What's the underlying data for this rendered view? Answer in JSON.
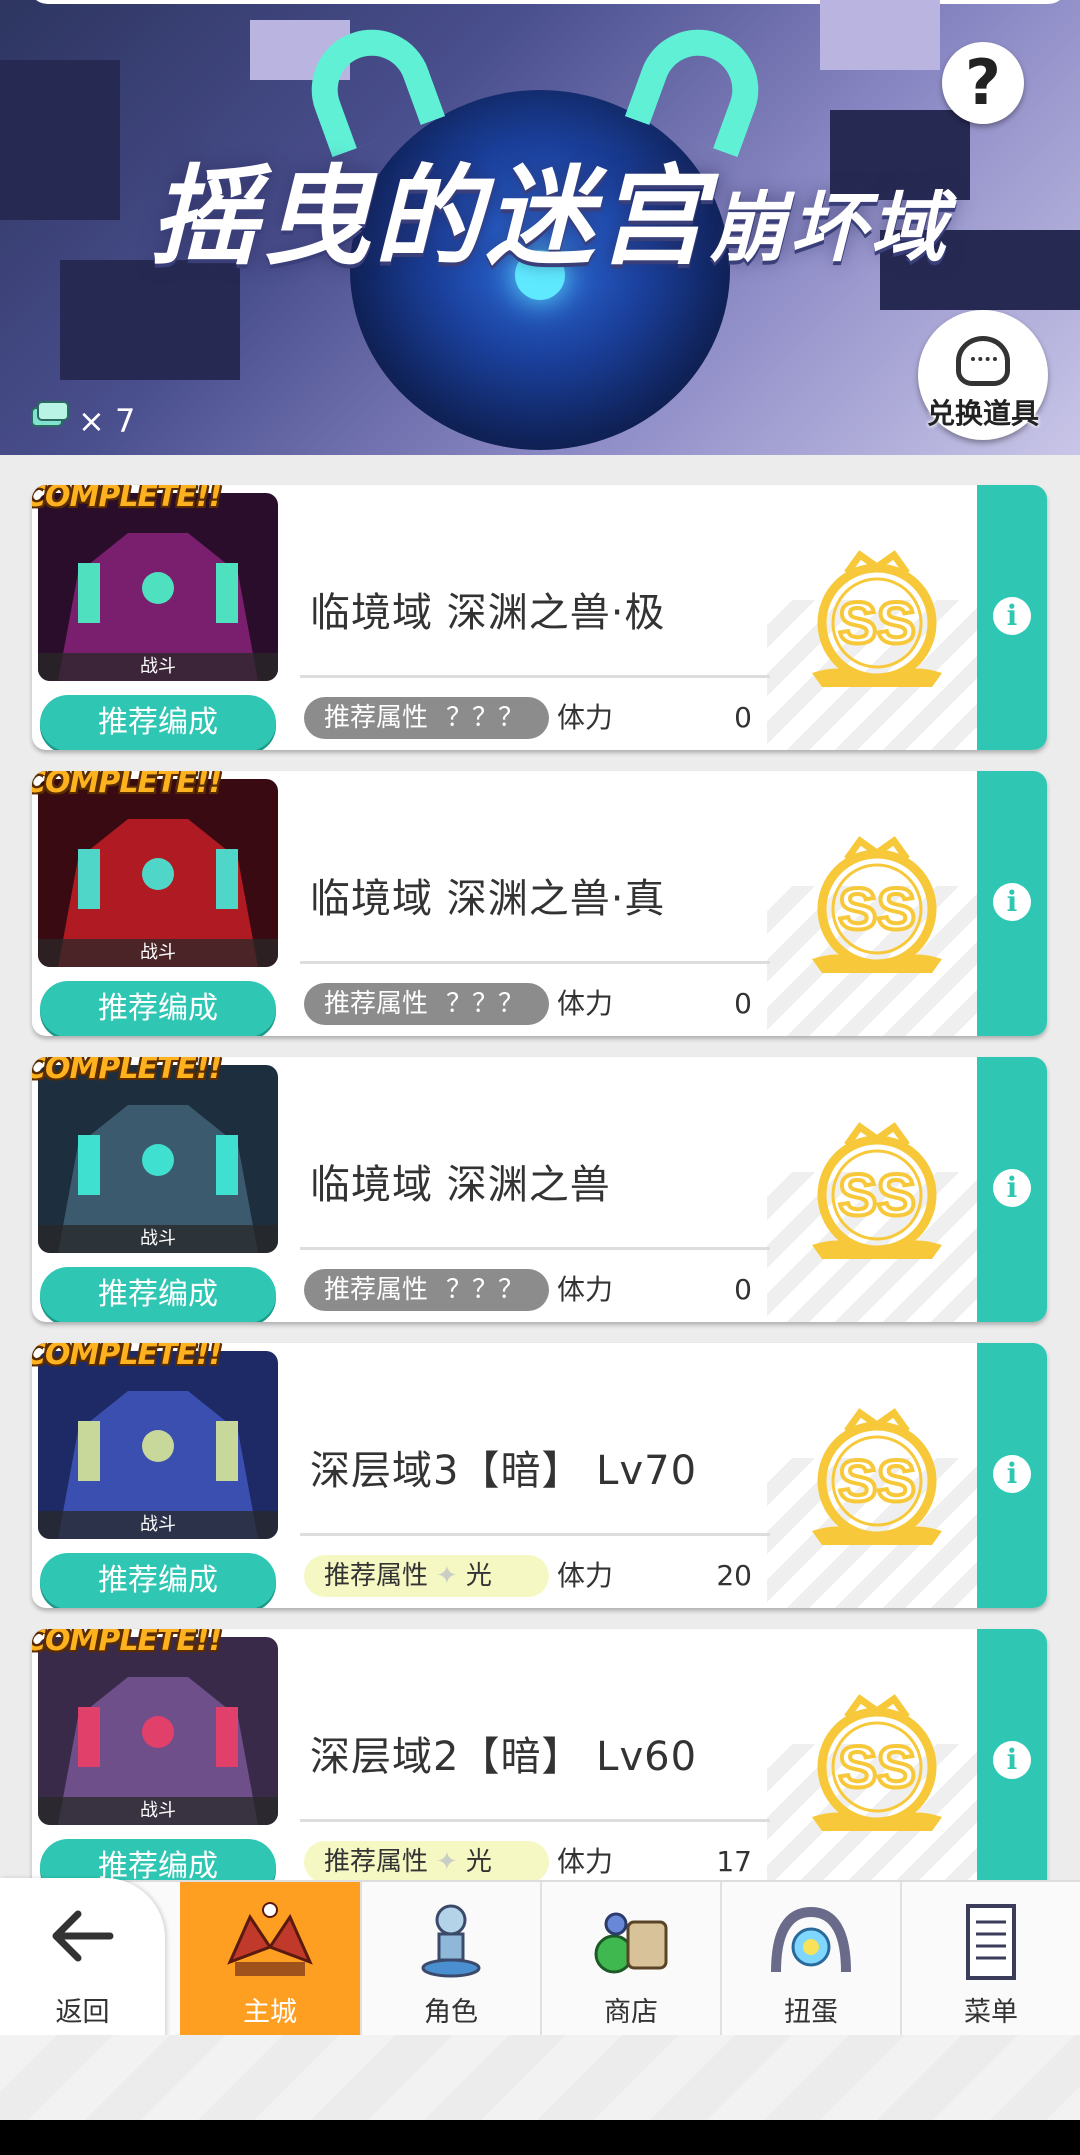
{
  "banner": {
    "title_parts": [
      "摇曳的",
      "迷宫",
      "崩坏域"
    ],
    "help_label": "?",
    "exchange_label": "兑换道具",
    "ticket_count": "× 7"
  },
  "stages": [
    {
      "complete": "COMPLETE!!",
      "battle": "战斗",
      "recommend": "推荐编成",
      "name": "临境域 深渊之兽·极",
      "attr_label": "推荐属性",
      "attr_value": "？？？",
      "attr_type": "unknown",
      "stamina_label": "体力",
      "stamina": "0",
      "rank": "SS",
      "thumb_colors": [
        "#2a0d2a",
        "#7a1f6e",
        "#4fe0c0"
      ]
    },
    {
      "complete": "COMPLETE!!",
      "battle": "战斗",
      "recommend": "推荐编成",
      "name": "临境域 深渊之兽·真",
      "attr_label": "推荐属性",
      "attr_value": "？？？",
      "attr_type": "unknown",
      "stamina_label": "体力",
      "stamina": "0",
      "rank": "SS",
      "thumb_colors": [
        "#3a0a12",
        "#b01a22",
        "#4fd6c8"
      ]
    },
    {
      "complete": "COMPLETE!!",
      "battle": "战斗",
      "recommend": "推荐编成",
      "name": "临境域 深渊之兽",
      "attr_label": "推荐属性",
      "attr_value": "？？？",
      "attr_type": "unknown",
      "stamina_label": "体力",
      "stamina": "0",
      "rank": "SS",
      "thumb_colors": [
        "#1d2f3e",
        "#3c5a6e",
        "#3fe0d0"
      ]
    },
    {
      "complete": "COMPLETE!!",
      "battle": "战斗",
      "recommend": "推荐编成",
      "name": "深层域3【暗】 Lv70",
      "attr_label": "推荐属性",
      "attr_value": "光",
      "attr_type": "light",
      "stamina_label": "体力",
      "stamina": "20",
      "rank": "SS",
      "thumb_colors": [
        "#1e2a66",
        "#3b4fb0",
        "#c8d89a"
      ]
    },
    {
      "complete": "COMPLETE!!",
      "battle": "战斗",
      "recommend": "推荐编成",
      "name": "深层域2【暗】 Lv60",
      "attr_label": "推荐属性",
      "attr_value": "光",
      "attr_type": "light",
      "stamina_label": "体力",
      "stamina": "17",
      "rank": "SS",
      "thumb_colors": [
        "#3a2a4a",
        "#6e4f8a",
        "#e0406a"
      ]
    }
  ],
  "nav": {
    "back": "返回",
    "items": [
      "主城",
      "角色",
      "商店",
      "扭蛋",
      "菜单"
    ],
    "active": "主城"
  },
  "colors": {
    "accent": "#2fc7b3",
    "active_tab": "#ff9f22",
    "rank_gold": "#f7c93a"
  }
}
